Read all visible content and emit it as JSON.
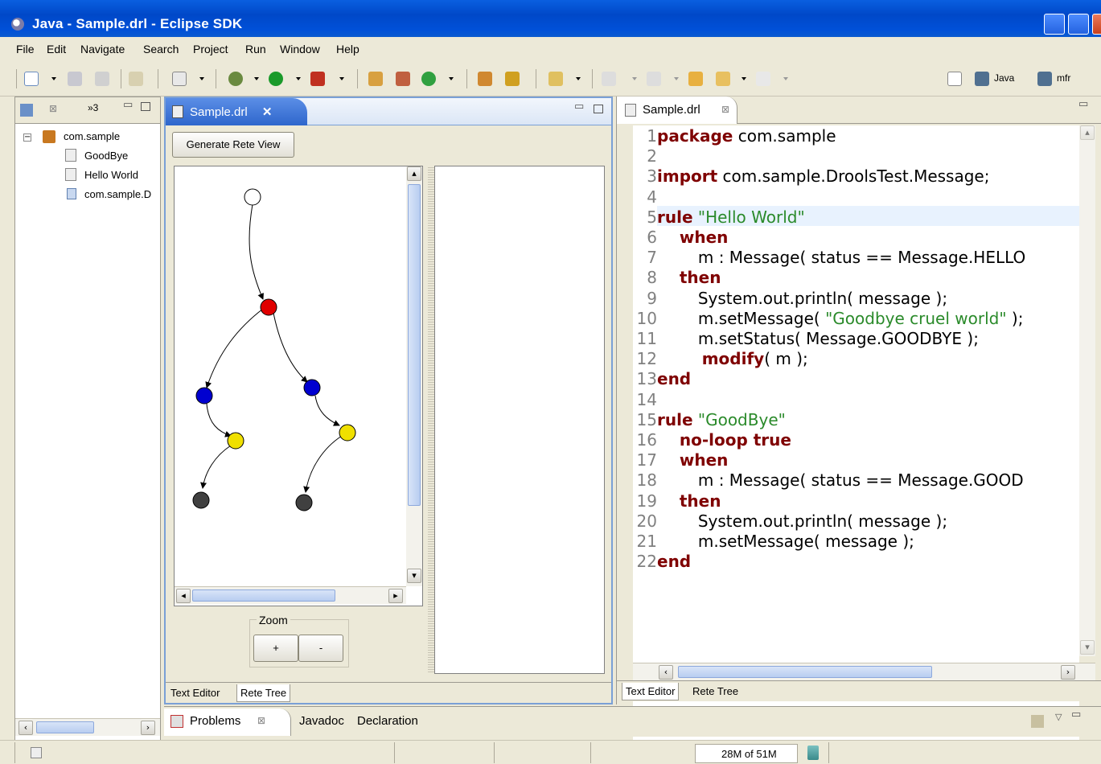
{
  "window": {
    "title": "Java - Sample.drl - Eclipse SDK"
  },
  "menu": [
    "File",
    "Edit",
    "Navigate",
    "Search",
    "Project",
    "Run",
    "Window",
    "Help"
  ],
  "perspectives": {
    "java": "Java",
    "mfr": "mfr"
  },
  "package_explorer": {
    "tab_count": "»3",
    "items": [
      "com.sample",
      "GoodBye",
      "Hello World",
      "com.sample.D"
    ]
  },
  "rete_editor": {
    "tab_title": "Sample.drl",
    "generate_button": "Generate Rete View",
    "zoom_label": "Zoom",
    "zoom_in": "+",
    "zoom_out": "-",
    "bottom_tabs": [
      "Text Editor",
      "Rete Tree"
    ],
    "nodes_colors": {
      "root": "#ffffff",
      "red": "#e00000",
      "blue": "#0000d0",
      "yellow": "#f0e000",
      "dark": "#404040"
    }
  },
  "code_editor": {
    "tab_title": "Sample.drl",
    "bottom_tabs": [
      "Text Editor",
      "Rete Tree"
    ],
    "lines": [
      {
        "n": "1",
        "kw": "package",
        "rest": " com.sample",
        "str": "",
        "after": ""
      },
      {
        "n": "2",
        "kw": "",
        "rest": "",
        "str": "",
        "after": ""
      },
      {
        "n": "3",
        "kw": "import",
        "rest": " com.sample.DroolsTest.Message;",
        "str": "",
        "after": ""
      },
      {
        "n": "4",
        "kw": "",
        "rest": "",
        "str": "",
        "after": ""
      },
      {
        "n": "5",
        "kw": "rule",
        "rest": " ",
        "str": "\"Hello World\"",
        "after": ""
      },
      {
        "n": "6",
        "kw": "    when",
        "rest": "",
        "str": "",
        "after": ""
      },
      {
        "n": "7",
        "kw": "",
        "rest": "        m : Message( status == Message.HELLO",
        "str": "",
        "after": ""
      },
      {
        "n": "8",
        "kw": "    then",
        "rest": "",
        "str": "",
        "after": ""
      },
      {
        "n": "9",
        "kw": "",
        "rest": "        System.out.println( message );",
        "str": "",
        "after": ""
      },
      {
        "n": "10",
        "kw": "",
        "rest": "        m.setMessage( ",
        "str": "\"Goodbye cruel world\"",
        "after": " );"
      },
      {
        "n": "11",
        "kw": "",
        "rest": "        m.setStatus( Message.GOODBYE );",
        "str": "",
        "after": ""
      },
      {
        "n": "12",
        "kw": "        modify",
        "rest": "( m );",
        "str": "",
        "after": ""
      },
      {
        "n": "13",
        "kw": "end",
        "rest": "",
        "str": "",
        "after": ""
      },
      {
        "n": "14",
        "kw": "",
        "rest": "",
        "str": "",
        "after": ""
      },
      {
        "n": "15",
        "kw": "rule",
        "rest": " ",
        "str": "\"GoodBye\"",
        "after": ""
      },
      {
        "n": "16",
        "kw": "    no-loop true",
        "rest": "",
        "str": "",
        "after": ""
      },
      {
        "n": "17",
        "kw": "    when",
        "rest": "",
        "str": "",
        "after": ""
      },
      {
        "n": "18",
        "kw": "",
        "rest": "        m : Message( status == Message.GOOD",
        "str": "",
        "after": ""
      },
      {
        "n": "19",
        "kw": "    then",
        "rest": "",
        "str": "",
        "after": ""
      },
      {
        "n": "20",
        "kw": "",
        "rest": "        System.out.println( message );",
        "str": "",
        "after": ""
      },
      {
        "n": "21",
        "kw": "",
        "rest": "        m.setMessage( message );",
        "str": "",
        "after": ""
      },
      {
        "n": "22",
        "kw": "end",
        "rest": "",
        "str": "",
        "after": ""
      }
    ]
  },
  "bottom_panel": {
    "tabs": [
      "Problems",
      "Javadoc",
      "Declaration"
    ]
  },
  "status": {
    "memory": "28M of 51M"
  },
  "colors": {
    "keyword": "#7f0000",
    "string": "#2a8a2a",
    "title_bar": "#0050d8"
  }
}
